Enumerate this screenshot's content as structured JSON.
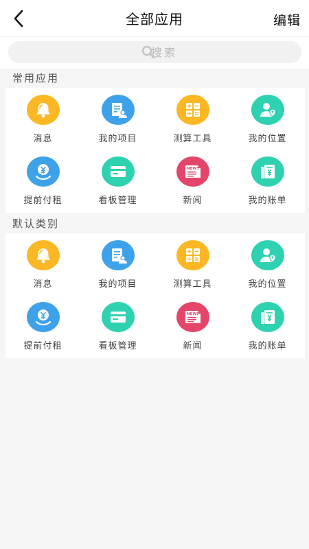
{
  "header": {
    "title": "全部应用",
    "edit_label": "编辑"
  },
  "search": {
    "placeholder": "搜索"
  },
  "sections": [
    {
      "title": "常用应用",
      "apps": [
        {
          "label": "消息",
          "icon": "bell-icon",
          "color": "#fbb824"
        },
        {
          "label": "我的项目",
          "icon": "project-icon",
          "color": "#3ea2ea"
        },
        {
          "label": "测算工具",
          "icon": "calculator-icon",
          "color": "#fbb824"
        },
        {
          "label": "我的位置",
          "icon": "location-icon",
          "color": "#2fd2b0"
        },
        {
          "label": "提前付租",
          "icon": "prepay-rent-icon",
          "color": "#3ea2ea"
        },
        {
          "label": "看板管理",
          "icon": "board-icon",
          "color": "#2fd2b0"
        },
        {
          "label": "新闻",
          "icon": "news-icon",
          "color": "#e4466a"
        },
        {
          "label": "我的账单",
          "icon": "bill-icon",
          "color": "#2fd2b0"
        }
      ]
    },
    {
      "title": "默认类别",
      "apps": [
        {
          "label": "消息",
          "icon": "bell-icon",
          "color": "#fbb824"
        },
        {
          "label": "我的项目",
          "icon": "project-icon",
          "color": "#3ea2ea"
        },
        {
          "label": "测算工具",
          "icon": "calculator-icon",
          "color": "#fbb824"
        },
        {
          "label": "我的位置",
          "icon": "location-icon",
          "color": "#2fd2b0"
        },
        {
          "label": "提前付租",
          "icon": "prepay-rent-icon",
          "color": "#3ea2ea"
        },
        {
          "label": "看板管理",
          "icon": "board-icon",
          "color": "#2fd2b0"
        },
        {
          "label": "新闻",
          "icon": "news-icon",
          "color": "#e4466a"
        },
        {
          "label": "我的账单",
          "icon": "bill-icon",
          "color": "#2fd2b0"
        }
      ]
    }
  ]
}
